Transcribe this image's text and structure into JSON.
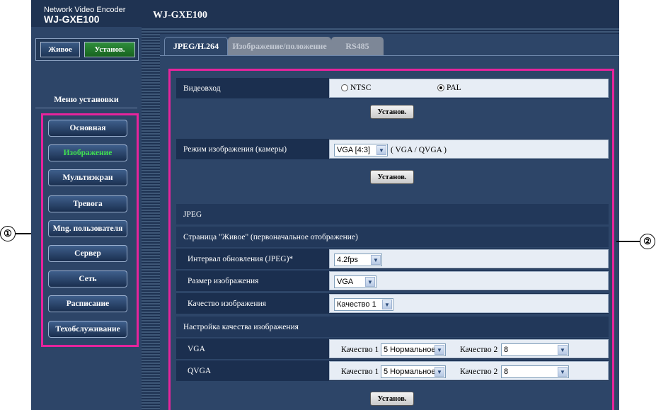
{
  "header": {
    "product_subtitle": "Network Video Encoder",
    "product_model": "WJ-GXE100",
    "page_title": "WJ-GXE100"
  },
  "mode": {
    "live": "Живое",
    "setup": "Установ."
  },
  "menu": {
    "title": "Меню установки",
    "items": [
      {
        "label": "Основная"
      },
      {
        "label": "Изображение"
      },
      {
        "label": "Мультиэкран"
      },
      {
        "label": "Тревога"
      },
      {
        "label": "Mng. пользователя"
      },
      {
        "label": "Сервер"
      },
      {
        "label": "Сеть"
      },
      {
        "label": "Расписание"
      },
      {
        "label": "Техобслуживание"
      }
    ],
    "active_index": 1,
    "active_color": "#40e050"
  },
  "tabs": [
    {
      "label": "JPEG/H.264"
    },
    {
      "label": "Изображение/положение"
    },
    {
      "label": "RS485"
    }
  ],
  "callouts": {
    "left": "①",
    "right": "②"
  },
  "annotation_color": "#e6249c",
  "form": {
    "video_input": {
      "label": "Видеовход",
      "ntsc": "NTSC",
      "pal": "PAL",
      "selected": "PAL"
    },
    "set_button": "Установ.",
    "image_mode": {
      "label": "Режим изображения (камеры)",
      "value": "VGA [4:3]",
      "note": "( VGA / QVGA )"
    },
    "jpeg": {
      "header": "JPEG",
      "live_page": "Страница \"Живое\" (первоначальное отображение)",
      "refresh": {
        "label": "Интервал обновления (JPEG)*",
        "value": "4.2fps"
      },
      "size": {
        "label": "Размер изображения",
        "value": "VGA"
      },
      "quality": {
        "label": "Качество изображения",
        "value": "Качество 1"
      }
    },
    "quality_settings": {
      "header": "Настройка качества изображения",
      "q1_label": "Качество 1",
      "q2_label": "Качество 2",
      "vga": {
        "label": "VGA",
        "q1": "5 Нормальное",
        "q2": "8"
      },
      "qvga": {
        "label": "QVGA",
        "q1": "5 Нормальное",
        "q2": "8"
      }
    }
  }
}
